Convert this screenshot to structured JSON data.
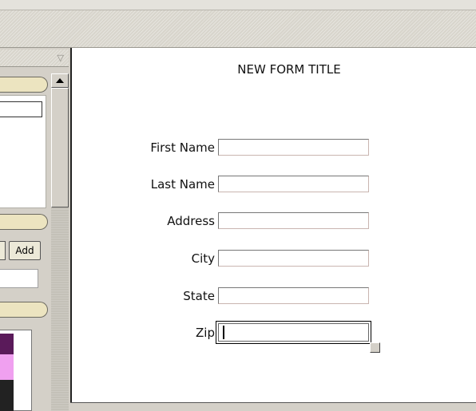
{
  "form": {
    "title": "NEW FORM TITLE",
    "fields": [
      {
        "label": "First Name",
        "value": ""
      },
      {
        "label": "Last Name",
        "value": ""
      },
      {
        "label": "Address",
        "value": ""
      },
      {
        "label": "City",
        "value": ""
      },
      {
        "label": "State",
        "value": ""
      },
      {
        "label": "Zip",
        "value": ""
      }
    ]
  },
  "left_panel": {
    "add_label": "Add",
    "swatches": [
      "#5a1a5a",
      "#f0a0f0",
      "#222222"
    ]
  },
  "icons": {
    "panel_menu": "triangle-down-icon",
    "scroll_up": "arrow-up-icon",
    "resize": "resize-handle-icon"
  }
}
